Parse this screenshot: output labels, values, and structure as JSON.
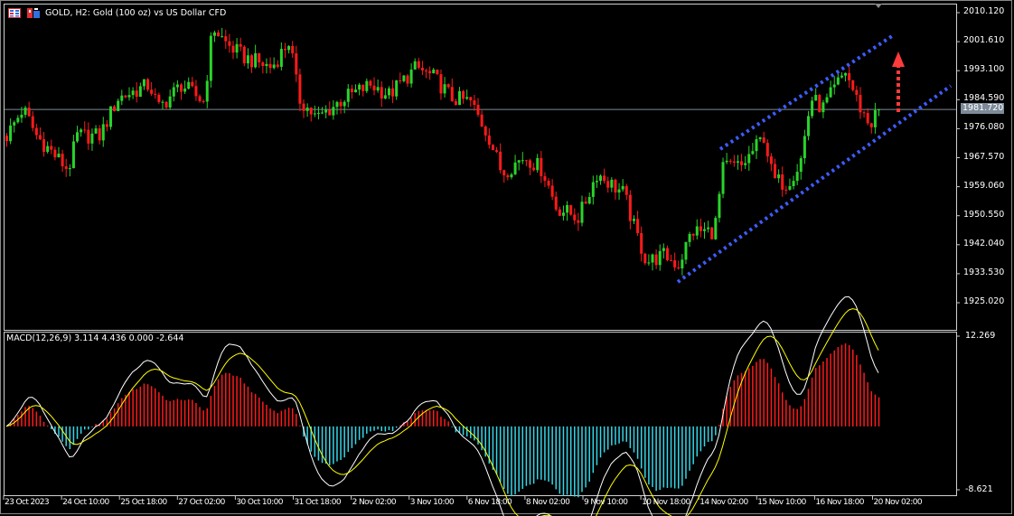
{
  "header": {
    "title": "GOLD, H2:  Gold (100 oz) vs US Dollar CFD",
    "icons": [
      "chart-list-icon",
      "one-click-trading-icon"
    ]
  },
  "price_axis": {
    "ticks": [
      "2010.120",
      "2001.610",
      "1993.100",
      "1984.590",
      "1976.080",
      "1967.570",
      "1959.060",
      "1950.550",
      "1942.040",
      "1933.530",
      "1925.020"
    ],
    "current_price": "1981.720"
  },
  "macd": {
    "label": "MACD(12,26,9) 3.114 4.436 0.000 -2.644",
    "axis_top": "12.269",
    "axis_bottom": "-8.621"
  },
  "time_axis": {
    "labels": [
      "23 Oct 2023",
      "24 Oct 10:00",
      "25 Oct 18:00",
      "27 Oct 02:00",
      "30 Oct 10:00",
      "31 Oct 18:00",
      "2 Nov 02:00",
      "3 Nov 10:00",
      "6 Nov 18:00",
      "8 Nov 02:00",
      "9 Nov 10:00",
      "10 Nov 18:00",
      "14 Nov 02:00",
      "15 Nov 10:00",
      "16 Nov 18:00",
      "20 Nov 02:00"
    ]
  },
  "chart_data": {
    "type": "candlestick",
    "symbol": "GOLD",
    "timeframe": "H2",
    "ylim": [
      1925.02,
      2010.12
    ],
    "price_path_anchors": [
      [
        0,
        1974
      ],
      [
        18,
        1982
      ],
      [
        33,
        1974
      ],
      [
        68,
        1964
      ],
      [
        78,
        1974
      ],
      [
        103,
        1974
      ],
      [
        123,
        1985
      ],
      [
        158,
        1989
      ],
      [
        168,
        1982
      ],
      [
        193,
        1989
      ],
      [
        218,
        1984
      ],
      [
        228,
        2006
      ],
      [
        243,
        2001
      ],
      [
        263,
        1997
      ],
      [
        293,
        1994
      ],
      [
        313,
        2002
      ],
      [
        323,
        1985
      ],
      [
        343,
        1979
      ],
      [
        373,
        1985
      ],
      [
        403,
        1989
      ],
      [
        423,
        1986
      ],
      [
        453,
        1994
      ],
      [
        473,
        1991
      ],
      [
        493,
        1985
      ],
      [
        513,
        1984
      ],
      [
        533,
        1974
      ],
      [
        548,
        1963
      ],
      [
        573,
        1968
      ],
      [
        593,
        1964
      ],
      [
        608,
        1953
      ],
      [
        633,
        1950
      ],
      [
        653,
        1963
      ],
      [
        683,
        1957
      ],
      [
        693,
        1948
      ],
      [
        708,
        1937
      ],
      [
        728,
        1939
      ],
      [
        743,
        1936
      ],
      [
        758,
        1946
      ],
      [
        783,
        1946
      ],
      [
        793,
        1965
      ],
      [
        813,
        1965
      ],
      [
        838,
        1974
      ],
      [
        848,
        1961
      ],
      [
        863,
        1960
      ],
      [
        878,
        1966
      ],
      [
        890,
        1985
      ],
      [
        903,
        1982
      ],
      [
        928,
        1993
      ],
      [
        943,
        1983
      ],
      [
        955,
        1977
      ],
      [
        965,
        1982
      ]
    ],
    "last_price": 1981.72,
    "channel": {
      "color": "#3d5cff",
      "style": "dotted"
    },
    "arrow": {
      "direction": "up",
      "color": "#ff3b3b",
      "style": "dotted"
    },
    "colors": {
      "bull": "#29d42b",
      "bear": "#ff1a1a",
      "macd_pos": "#ff1a1a",
      "macd_neg": "#35d6e8",
      "macd_line": "#ffffff",
      "signal_line": "#ffff00"
    }
  }
}
